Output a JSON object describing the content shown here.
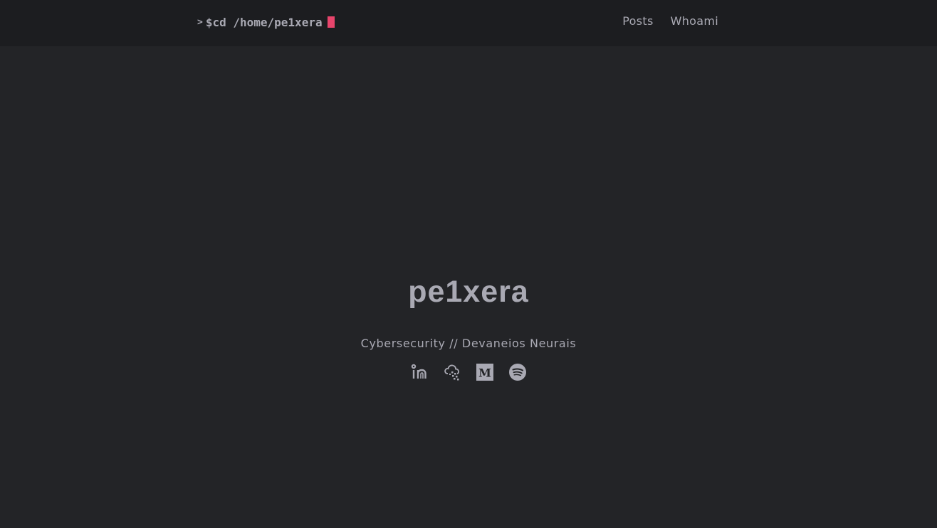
{
  "header": {
    "logo": {
      "prompt": ">",
      "text": "$cd /home/pe1xera",
      "cursor_color": "#e7456c"
    },
    "nav": [
      {
        "label": "Posts"
      },
      {
        "label": "Whoami"
      }
    ]
  },
  "hero": {
    "title": "pe1xera",
    "subtitle": "Cybersecurity // Devaneios Neurais"
  },
  "social": [
    {
      "icon": "linkedin-icon"
    },
    {
      "icon": "cloud-icon"
    },
    {
      "icon": "medium-icon"
    },
    {
      "icon": "spotify-icon"
    }
  ],
  "colors": {
    "background": "#232427",
    "header_background": "#1c1d20",
    "text": "#a9a9b3",
    "accent": "#e7456c"
  }
}
